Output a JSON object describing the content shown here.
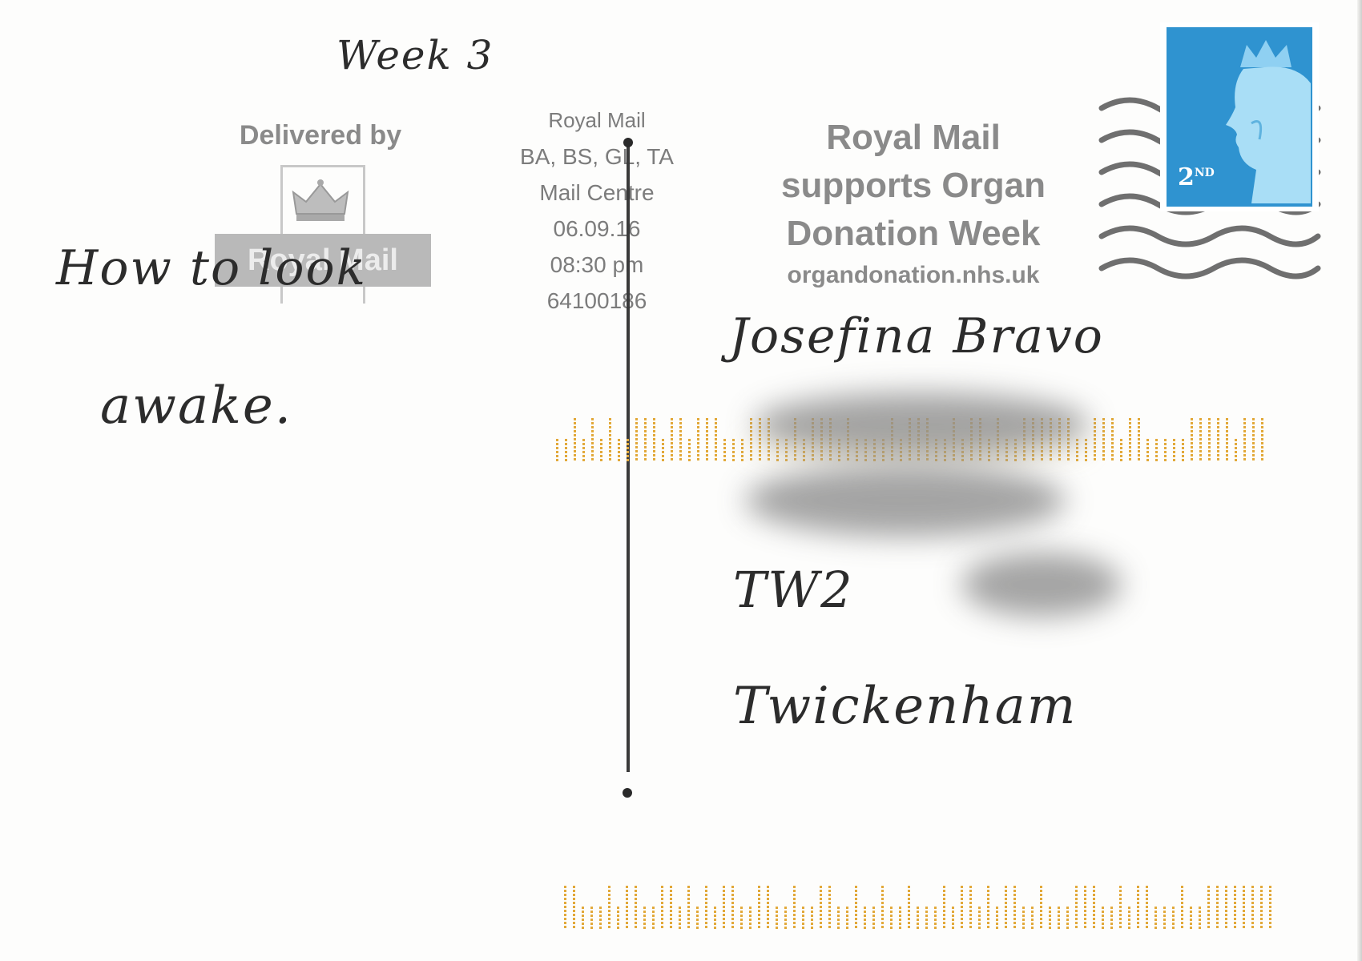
{
  "postcard": {
    "week_note": "Week 3",
    "message_line1": "How to look",
    "message_line2": "awake.",
    "delivered_by": {
      "label": "Delivered by",
      "brand": "Royal Mail"
    },
    "postmark": {
      "title": "Royal Mail",
      "areas": "BA, BS, GL, TA",
      "centre": "Mail Centre",
      "date": "06.09.16",
      "time": "08:30 pm",
      "code": "64100186"
    },
    "slogan": {
      "line1": "Royal Mail",
      "line2": "supports Organ",
      "line3": "Donation Week",
      "url": "organdonation.nhs.uk"
    },
    "stamp": {
      "value": "2",
      "value_suffix": "ND",
      "color": "#2f93d0"
    },
    "address": {
      "name": "Josefina Bravo",
      "postcode": "TW2",
      "town": "Twickenham"
    },
    "phosphor_color": "#e2a93a"
  }
}
